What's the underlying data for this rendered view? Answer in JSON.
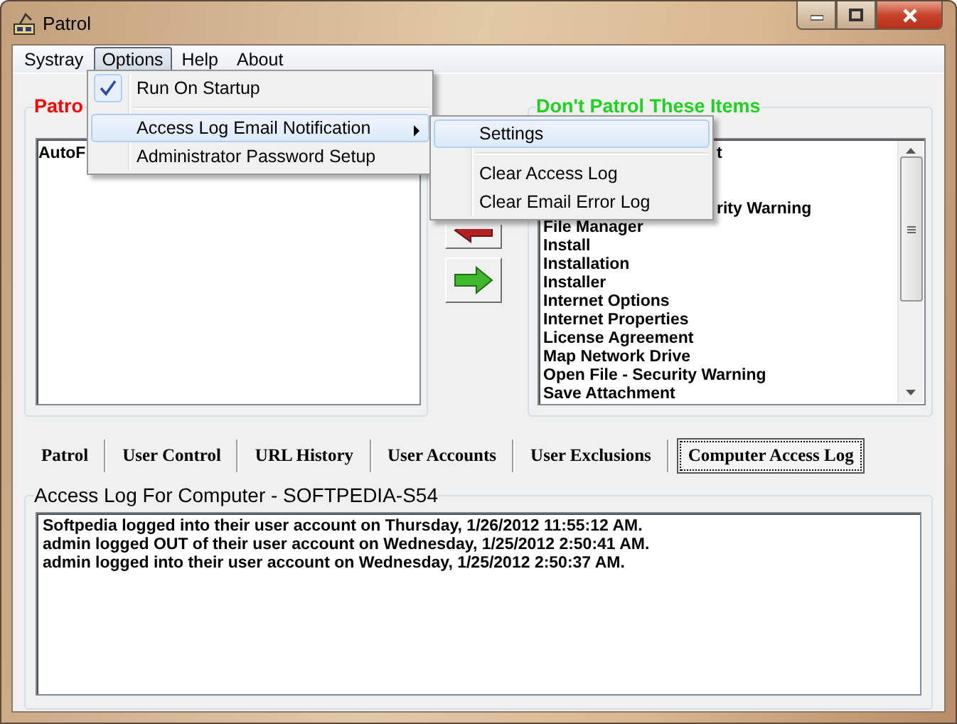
{
  "window": {
    "title": "Patrol"
  },
  "menu_bar": [
    {
      "label": "Systray",
      "selected": false
    },
    {
      "label": "Options",
      "selected": true
    },
    {
      "label": "Help",
      "selected": false
    },
    {
      "label": "About",
      "selected": false
    }
  ],
  "options_menu": [
    {
      "kind": "check",
      "label": "Run On Startup",
      "checked": true,
      "highlighted": false
    },
    {
      "kind": "separator"
    },
    {
      "kind": "submenu",
      "label": "Access Log Email Notification",
      "highlighted": true
    },
    {
      "kind": "item",
      "label": "Administrator Password Setup",
      "highlighted": false
    }
  ],
  "submenu": [
    {
      "kind": "item",
      "label": "Settings",
      "highlighted": true
    },
    {
      "kind": "separator"
    },
    {
      "kind": "item",
      "label": "Clear Access Log",
      "highlighted": false
    },
    {
      "kind": "item",
      "label": "Clear Email Error Log",
      "highlighted": false
    }
  ],
  "patrol_group": {
    "title": "Patro",
    "items": [
      "AutoF"
    ]
  },
  "exclude_group": {
    "title": "Don't Patrol These Items",
    "items": [
      {
        "kind": "covered",
        "label": "t"
      },
      {
        "kind": "covered",
        "label": "rity Warning"
      },
      {
        "kind": "row",
        "label": "File Manager"
      },
      {
        "kind": "row",
        "label": "Install"
      },
      {
        "kind": "row",
        "label": "Installation"
      },
      {
        "kind": "row",
        "label": "Installer"
      },
      {
        "kind": "row",
        "label": "Internet Options"
      },
      {
        "kind": "row",
        "label": "Internet Properties"
      },
      {
        "kind": "row",
        "label": "License Agreement"
      },
      {
        "kind": "row",
        "label": "Map Network Drive"
      },
      {
        "kind": "row",
        "label": "Open File - Security Warning"
      },
      {
        "kind": "row",
        "label": "Save Attachment"
      }
    ]
  },
  "tabs": [
    {
      "label": "Patrol",
      "selected": false
    },
    {
      "label": "User Control",
      "selected": false
    },
    {
      "label": "URL History",
      "selected": false
    },
    {
      "label": "User Accounts",
      "selected": false
    },
    {
      "label": "User Exclusions",
      "selected": false
    },
    {
      "label": "Computer Access Log",
      "selected": true
    }
  ],
  "access_log": {
    "title": "Access Log For Computer - SOFTPEDIA-S54",
    "lines": [
      "Softpedia logged into their user account on Thursday, 1/26/2012 11:55:12 AM.",
      "admin logged OUT of their user account on Wednesday, 1/25/2012 2:50:41 AM.",
      "admin logged into their user account on Wednesday, 1/25/2012 2:50:37 AM."
    ]
  }
}
